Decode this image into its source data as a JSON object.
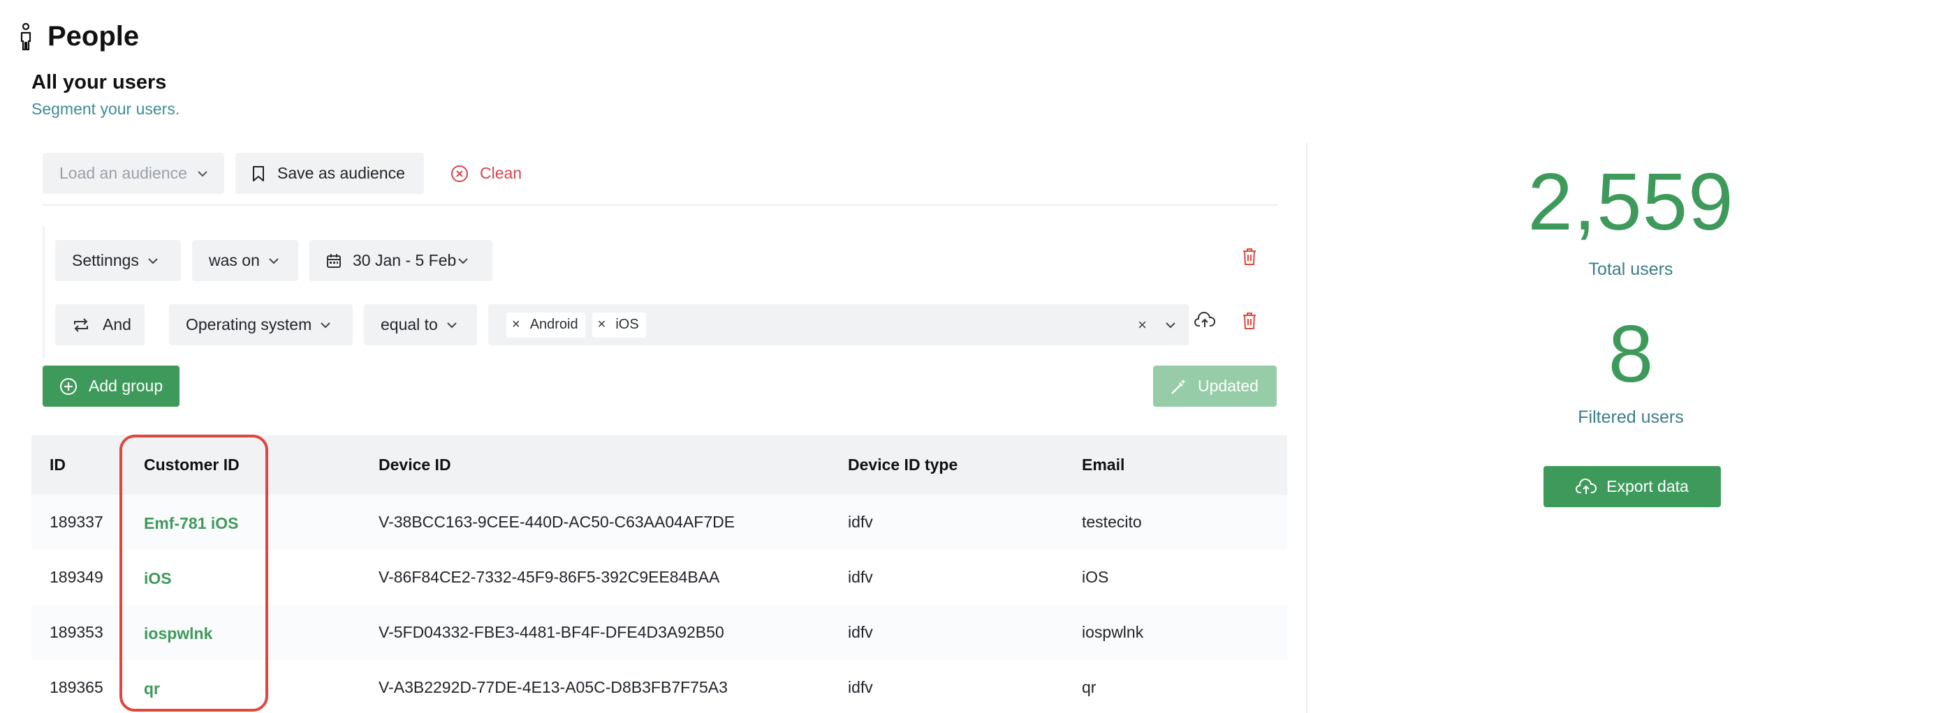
{
  "header": {
    "title": "People",
    "icon": "person-icon"
  },
  "section": {
    "title": "All your users",
    "description": "Segment your users."
  },
  "toolbar": {
    "load_audience": "Load an audience",
    "save_audience": "Save as audience",
    "clean": "Clean"
  },
  "filters": {
    "row1": {
      "event": "Settinngs",
      "operator": "was on",
      "date_range": "30 Jan - 5 Feb"
    },
    "row2": {
      "connector": "And",
      "property": "Operating system",
      "operator": "equal to",
      "values": [
        "Android",
        "iOS"
      ]
    }
  },
  "actions": {
    "add_group": "Add group",
    "updated": "Updated"
  },
  "table": {
    "headers": [
      "ID",
      "Customer ID",
      "Device ID",
      "Device ID type",
      "Email"
    ],
    "rows": [
      [
        "189337",
        "Emf-781 iOS",
        "V-38BCC163-9CEE-440D-AC50-C63AA04AF7DE",
        "idfv",
        "testecito"
      ],
      [
        "189349",
        "iOS",
        "V-86F84CE2-7332-45F9-86F5-392C9EE84BAA",
        "idfv",
        "iOS"
      ],
      [
        "189353",
        "iospwlnk",
        "V-5FD04332-FBE3-4481-BF4F-DFE4D3A92B50",
        "idfv",
        "iospwlnk"
      ],
      [
        "189365",
        "qr",
        "V-A3B2292D-77DE-4E13-A05C-D8B3FB7F75A3",
        "idfv",
        "qr"
      ]
    ]
  },
  "stats": {
    "total_users": "2,559",
    "total_label": "Total users",
    "filtered_users": "8",
    "filtered_label": "Filtered users",
    "export": "Export data"
  },
  "colors": {
    "accent": "#3e9a5b",
    "danger": "#d6454e",
    "highlight": "#e0463b",
    "muted_link": "#3d8d96"
  }
}
